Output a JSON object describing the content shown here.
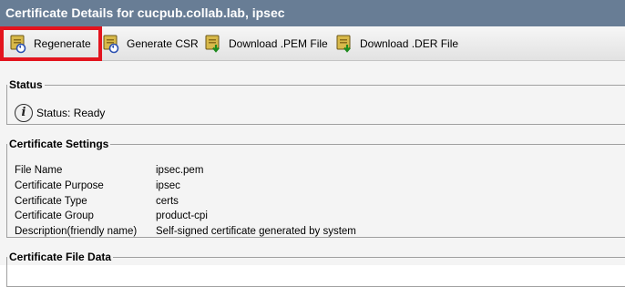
{
  "window": {
    "title": "Certificate Details for cucpub.collab.lab, ipsec"
  },
  "toolbar": {
    "buttons": [
      {
        "label": "Regenerate",
        "icon": "certificate-regenerate-icon"
      },
      {
        "label": "Generate CSR",
        "icon": "certificate-regenerate-icon"
      },
      {
        "label": "Download .PEM File",
        "icon": "certificate-download-icon"
      },
      {
        "label": "Download .DER File",
        "icon": "certificate-download-icon"
      }
    ]
  },
  "status": {
    "legend": "Status",
    "text": "Status: Ready",
    "icon": "info-icon"
  },
  "settings": {
    "legend": "Certificate Settings",
    "rows": [
      {
        "key": "File Name",
        "value": "ipsec.pem"
      },
      {
        "key": "Certificate Purpose",
        "value": "ipsec"
      },
      {
        "key": "Certificate Type",
        "value": "certs"
      },
      {
        "key": "Certificate Group",
        "value": "product-cpi"
      },
      {
        "key": "Description(friendly name)",
        "value": "Self-signed certificate generated by system"
      }
    ]
  },
  "file_data": {
    "legend": "Certificate File Data"
  },
  "colors": {
    "titlebar": "#687d95",
    "highlight": "#e3141e",
    "cert_body": "#d8b94a"
  }
}
